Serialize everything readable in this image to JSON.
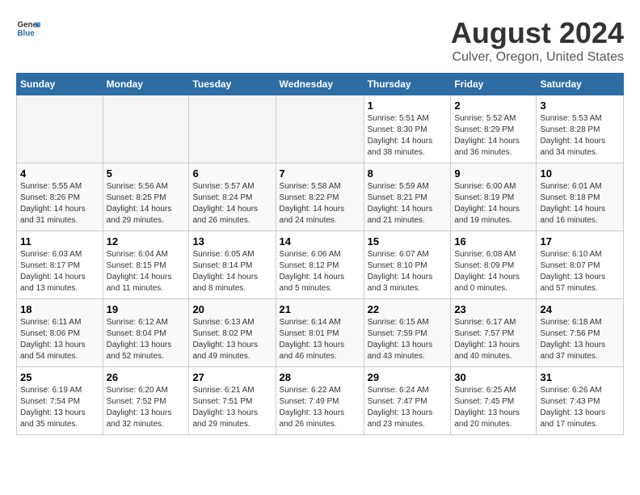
{
  "logo": {
    "general": "General",
    "blue": "Blue"
  },
  "title": "August 2024",
  "subtitle": "Culver, Oregon, United States",
  "headers": [
    "Sunday",
    "Monday",
    "Tuesday",
    "Wednesday",
    "Thursday",
    "Friday",
    "Saturday"
  ],
  "weeks": [
    {
      "days": [
        {
          "num": "",
          "info": ""
        },
        {
          "num": "",
          "info": ""
        },
        {
          "num": "",
          "info": ""
        },
        {
          "num": "",
          "info": ""
        },
        {
          "num": "1",
          "info": "Sunrise: 5:51 AM\nSunset: 8:30 PM\nDaylight: 14 hours\nand 38 minutes."
        },
        {
          "num": "2",
          "info": "Sunrise: 5:52 AM\nSunset: 8:29 PM\nDaylight: 14 hours\nand 36 minutes."
        },
        {
          "num": "3",
          "info": "Sunrise: 5:53 AM\nSunset: 8:28 PM\nDaylight: 14 hours\nand 34 minutes."
        }
      ]
    },
    {
      "days": [
        {
          "num": "4",
          "info": "Sunrise: 5:55 AM\nSunset: 8:26 PM\nDaylight: 14 hours\nand 31 minutes."
        },
        {
          "num": "5",
          "info": "Sunrise: 5:56 AM\nSunset: 8:25 PM\nDaylight: 14 hours\nand 29 minutes."
        },
        {
          "num": "6",
          "info": "Sunrise: 5:57 AM\nSunset: 8:24 PM\nDaylight: 14 hours\nand 26 minutes."
        },
        {
          "num": "7",
          "info": "Sunrise: 5:58 AM\nSunset: 8:22 PM\nDaylight: 14 hours\nand 24 minutes."
        },
        {
          "num": "8",
          "info": "Sunrise: 5:59 AM\nSunset: 8:21 PM\nDaylight: 14 hours\nand 21 minutes."
        },
        {
          "num": "9",
          "info": "Sunrise: 6:00 AM\nSunset: 8:19 PM\nDaylight: 14 hours\nand 19 minutes."
        },
        {
          "num": "10",
          "info": "Sunrise: 6:01 AM\nSunset: 8:18 PM\nDaylight: 14 hours\nand 16 minutes."
        }
      ]
    },
    {
      "days": [
        {
          "num": "11",
          "info": "Sunrise: 6:03 AM\nSunset: 8:17 PM\nDaylight: 14 hours\nand 13 minutes."
        },
        {
          "num": "12",
          "info": "Sunrise: 6:04 AM\nSunset: 8:15 PM\nDaylight: 14 hours\nand 11 minutes."
        },
        {
          "num": "13",
          "info": "Sunrise: 6:05 AM\nSunset: 8:14 PM\nDaylight: 14 hours\nand 8 minutes."
        },
        {
          "num": "14",
          "info": "Sunrise: 6:06 AM\nSunset: 8:12 PM\nDaylight: 14 hours\nand 5 minutes."
        },
        {
          "num": "15",
          "info": "Sunrise: 6:07 AM\nSunset: 8:10 PM\nDaylight: 14 hours\nand 3 minutes."
        },
        {
          "num": "16",
          "info": "Sunrise: 6:08 AM\nSunset: 8:09 PM\nDaylight: 14 hours\nand 0 minutes."
        },
        {
          "num": "17",
          "info": "Sunrise: 6:10 AM\nSunset: 8:07 PM\nDaylight: 13 hours\nand 57 minutes."
        }
      ]
    },
    {
      "days": [
        {
          "num": "18",
          "info": "Sunrise: 6:11 AM\nSunset: 8:06 PM\nDaylight: 13 hours\nand 54 minutes."
        },
        {
          "num": "19",
          "info": "Sunrise: 6:12 AM\nSunset: 8:04 PM\nDaylight: 13 hours\nand 52 minutes."
        },
        {
          "num": "20",
          "info": "Sunrise: 6:13 AM\nSunset: 8:02 PM\nDaylight: 13 hours\nand 49 minutes."
        },
        {
          "num": "21",
          "info": "Sunrise: 6:14 AM\nSunset: 8:01 PM\nDaylight: 13 hours\nand 46 minutes."
        },
        {
          "num": "22",
          "info": "Sunrise: 6:15 AM\nSunset: 7:59 PM\nDaylight: 13 hours\nand 43 minutes."
        },
        {
          "num": "23",
          "info": "Sunrise: 6:17 AM\nSunset: 7:57 PM\nDaylight: 13 hours\nand 40 minutes."
        },
        {
          "num": "24",
          "info": "Sunrise: 6:18 AM\nSunset: 7:56 PM\nDaylight: 13 hours\nand 37 minutes."
        }
      ]
    },
    {
      "days": [
        {
          "num": "25",
          "info": "Sunrise: 6:19 AM\nSunset: 7:54 PM\nDaylight: 13 hours\nand 35 minutes."
        },
        {
          "num": "26",
          "info": "Sunrise: 6:20 AM\nSunset: 7:52 PM\nDaylight: 13 hours\nand 32 minutes."
        },
        {
          "num": "27",
          "info": "Sunrise: 6:21 AM\nSunset: 7:51 PM\nDaylight: 13 hours\nand 29 minutes."
        },
        {
          "num": "28",
          "info": "Sunrise: 6:22 AM\nSunset: 7:49 PM\nDaylight: 13 hours\nand 26 minutes."
        },
        {
          "num": "29",
          "info": "Sunrise: 6:24 AM\nSunset: 7:47 PM\nDaylight: 13 hours\nand 23 minutes."
        },
        {
          "num": "30",
          "info": "Sunrise: 6:25 AM\nSunset: 7:45 PM\nDaylight: 13 hours\nand 20 minutes."
        },
        {
          "num": "31",
          "info": "Sunrise: 6:26 AM\nSunset: 7:43 PM\nDaylight: 13 hours\nand 17 minutes."
        }
      ]
    }
  ]
}
